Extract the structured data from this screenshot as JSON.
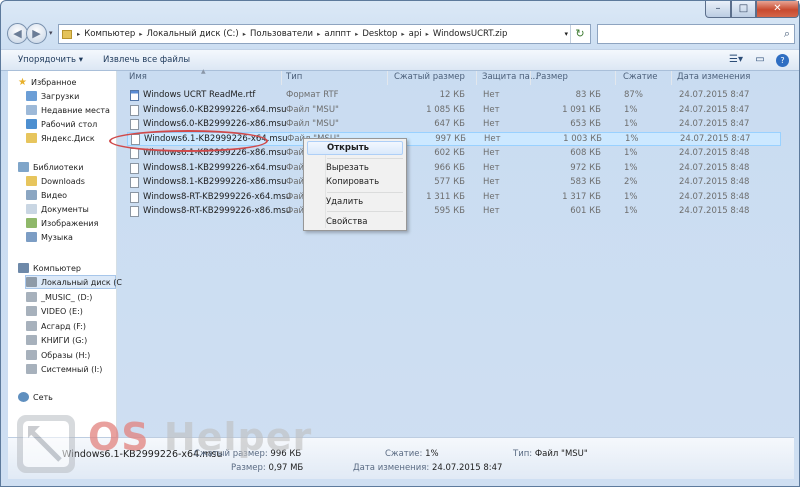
{
  "window": {
    "minimize": "–",
    "maximize": "□",
    "close": "✕"
  },
  "address": {
    "crumbs": [
      "Компьютер",
      "Локальный диск (C:)",
      "Пользователи",
      "алппт",
      "Desktop",
      "api",
      "WindowsUCRT.zip"
    ],
    "separator": "▸"
  },
  "toolbar": {
    "organize": "Упорядочить ▾",
    "extract_all": "Извлечь все файлы"
  },
  "nav": {
    "favorites": "Избранное",
    "fav_items": [
      "Загрузки",
      "Недавние места",
      "Рабочий стол",
      "Яндекс.Диск"
    ],
    "libraries": "Библиотеки",
    "lib_items": [
      "Downloads",
      "Видео",
      "Документы",
      "Изображения",
      "Музыка"
    ],
    "computer": "Компьютер",
    "drives": [
      "Локальный диск (C",
      "_MUSIC_ (D:)",
      "VIDEO (E:)",
      "Асгард (F:)",
      "КНИГИ (G:)",
      "Образы (H:)",
      "Системный (I:)"
    ],
    "network": "Сеть"
  },
  "columns": {
    "name": "Имя",
    "type": "Тип",
    "size": "Сжатый размер",
    "protect": "Защита па...",
    "orig": "Размер",
    "ratio": "Сжатие",
    "date": "Дата изменения"
  },
  "files": [
    {
      "name": "Windows UCRT ReadMe.rtf",
      "type": "Формат RTF",
      "size": "12 КБ",
      "protect": "Нет",
      "orig": "83 КБ",
      "ratio": "87%",
      "date": "24.07.2015 8:47"
    },
    {
      "name": "Windows6.0-KB2999226-x64.msu",
      "type": "Файл \"MSU\"",
      "size": "1 085 КБ",
      "protect": "Нет",
      "orig": "1 091 КБ",
      "ratio": "1%",
      "date": "24.07.2015 8:47"
    },
    {
      "name": "Windows6.0-KB2999226-x86.msu",
      "type": "Файл \"MSU\"",
      "size": "647 КБ",
      "protect": "Нет",
      "orig": "653 КБ",
      "ratio": "1%",
      "date": "24.07.2015 8:47"
    },
    {
      "name": "Windows6.1-KB2999226-x64.msu",
      "type": "Файл \"MSU\"",
      "size": "997 КБ",
      "protect": "Нет",
      "orig": "1 003 КБ",
      "ratio": "1%",
      "date": "24.07.2015 8:47"
    },
    {
      "name": "Windows6.1-KB2999226-x86.msu",
      "type": "Файл \"MSU\"",
      "size": "602 КБ",
      "protect": "Нет",
      "orig": "608 КБ",
      "ratio": "1%",
      "date": "24.07.2015 8:48"
    },
    {
      "name": "Windows8.1-KB2999226-x64.msu",
      "type": "Файл \"MSU\"",
      "size": "966 КБ",
      "protect": "Нет",
      "orig": "972 КБ",
      "ratio": "1%",
      "date": "24.07.2015 8:48"
    },
    {
      "name": "Windows8.1-KB2999226-x86.msu",
      "type": "Файл \"MSU\"",
      "size": "577 КБ",
      "protect": "Нет",
      "orig": "583 КБ",
      "ratio": "2%",
      "date": "24.07.2015 8:48"
    },
    {
      "name": "Windows8-RT-KB2999226-x64.msu",
      "type": "Файл \"MSU\"",
      "size": "1 311 КБ",
      "protect": "Нет",
      "orig": "1 317 КБ",
      "ratio": "1%",
      "date": "24.07.2015 8:48"
    },
    {
      "name": "Windows8-RT-KB2999226-x86.msu",
      "type": "Файл \"MSU\"",
      "size": "595 КБ",
      "protect": "Нет",
      "orig": "601 КБ",
      "ratio": "1%",
      "date": "24.07.2015 8:48"
    }
  ],
  "context_menu": {
    "open": "Открыть",
    "cut": "Вырезать",
    "copy": "Копировать",
    "delete": "Удалить",
    "properties": "Свойства"
  },
  "details": {
    "filename": "Windows6.1-KB2999226-x64.msu",
    "compressed_label": "Сжатый размер:",
    "compressed_value": "996 КБ",
    "ratio_label": "Сжатие:",
    "ratio_value": "1%",
    "type_label": "Тип:",
    "type_value": "Файл \"MSU\"",
    "size_label": "Размер:",
    "size_value": "0,97 МБ",
    "date_label": "Дата изменения:",
    "date_value": "24.07.2015 8:47"
  },
  "watermark": {
    "o": "OS",
    "rest": " Helper"
  },
  "colors": {
    "selection": "#cce8ff",
    "highlight_ring": "#d0494a",
    "close_button": "#c84a2f"
  }
}
